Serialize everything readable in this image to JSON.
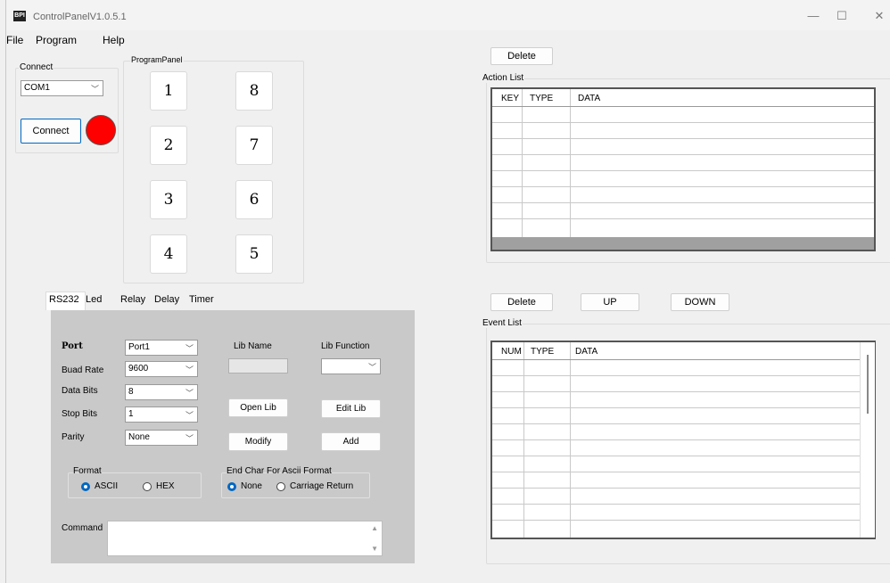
{
  "window": {
    "title": "ControlPanelV1.0.5.1",
    "icon_text": "BPI",
    "controls": {
      "minimize": "—",
      "maximize": "☐",
      "close": "✕"
    }
  },
  "menu": [
    "File",
    "Program",
    "Help"
  ],
  "connect": {
    "group_label": "Connect",
    "port_value": "COM1",
    "connect_label": "Connect",
    "status_color": "#ff0000"
  },
  "program_panel": {
    "label": "ProgramPanel",
    "keys": [
      "1",
      "8",
      "2",
      "7",
      "3",
      "6",
      "4",
      "5"
    ]
  },
  "action_list": {
    "delete_label": "Delete",
    "label": "Action List",
    "columns": [
      "KEY",
      "TYPE",
      "DATA"
    ]
  },
  "event_list": {
    "delete_label": "Delete",
    "up_label": "UP",
    "down_label": "DOWN",
    "label": "Event List",
    "columns": [
      "NUM",
      "TYPE",
      "DATA"
    ]
  },
  "tabs": [
    "RS232",
    "Led",
    "Relay",
    "Delay",
    "Timer"
  ],
  "rs232": {
    "port_label": "Port",
    "port_value": "Port1",
    "baud_label": "Buad Rate",
    "baud_value": "9600",
    "data_bits_label": "Data Bits",
    "data_bits_value": "8",
    "stop_bits_label": "Stop Bits",
    "stop_bits_value": "1",
    "parity_label": "Parity",
    "parity_value": "None",
    "lib_name_label": "Lib Name",
    "lib_function_label": "Lib Function",
    "open_lib_label": "Open Lib",
    "edit_lib_label": "Edit Lib",
    "modify_label": "Modify",
    "add_label": "Add",
    "format_label": "Format",
    "format_ascii": "ASCII",
    "format_hex": "HEX",
    "end_char_label": "End Char For Ascii Format",
    "end_none": "None",
    "end_cr": "Carriage Return",
    "command_label": "Command",
    "accent_color": "#0067c0"
  }
}
